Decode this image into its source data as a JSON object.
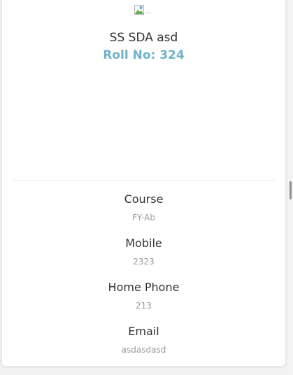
{
  "profile": {
    "avatar_alt": "...",
    "name": "SS SDA asd",
    "roll": "Roll No: 324"
  },
  "details": [
    {
      "label": "Course",
      "value": "FY-Ab"
    },
    {
      "label": "Mobile",
      "value": "2323"
    },
    {
      "label": "Home Phone",
      "value": "213"
    },
    {
      "label": "Email",
      "value": "asdasdasd"
    }
  ],
  "colors": {
    "accent": "#6fb3c9",
    "text": "#333333",
    "muted": "#9a9a9a"
  }
}
